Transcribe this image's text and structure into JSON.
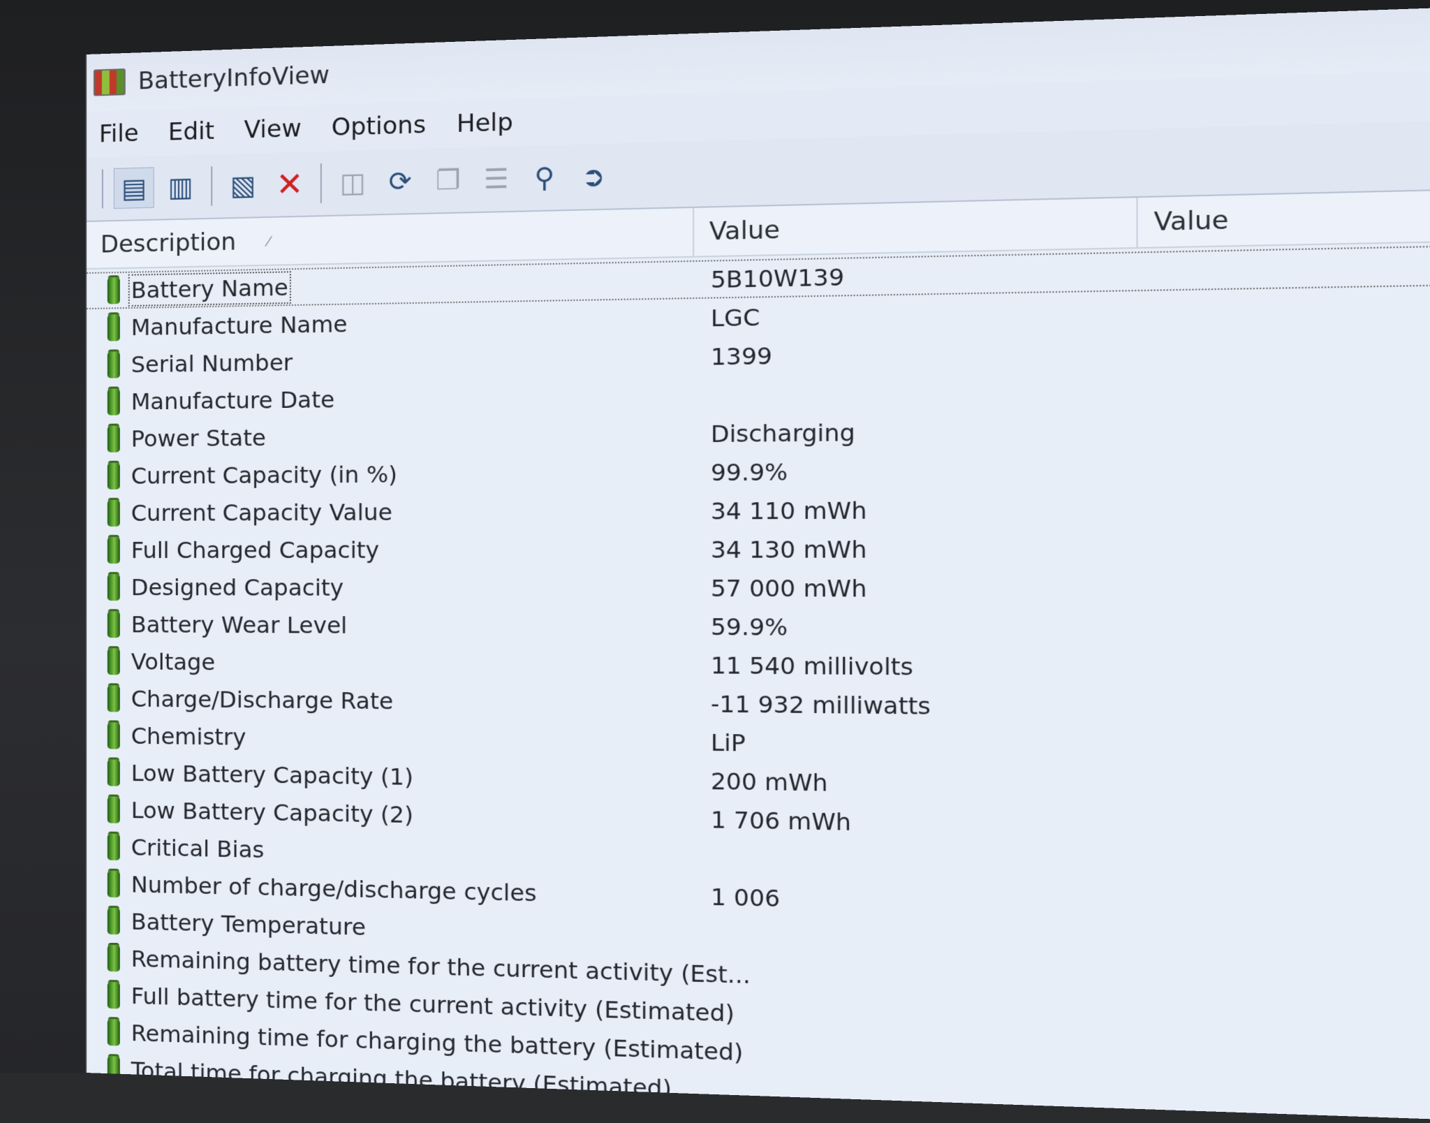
{
  "window": {
    "title": "BatteryInfoView"
  },
  "menu": [
    "File",
    "Edit",
    "View",
    "Options",
    "Help"
  ],
  "toolbar": {
    "icons": [
      "properties-icon",
      "clipboard-icon",
      "html-report-icon",
      "delete-icon",
      "save-icon",
      "refresh-icon",
      "copy-icon",
      "properties-disabled-icon",
      "find-icon",
      "exit-icon"
    ]
  },
  "columns": {
    "description": "Description",
    "value1": "Value",
    "value2": "Value"
  },
  "rows": [
    {
      "description": "Battery Name",
      "value": "5B10W139"
    },
    {
      "description": "Manufacture Name",
      "value": "LGC"
    },
    {
      "description": "Serial Number",
      "value": " 1399"
    },
    {
      "description": "Manufacture Date",
      "value": ""
    },
    {
      "description": "Power State",
      "value": "Discharging"
    },
    {
      "description": "Current Capacity (in %)",
      "value": "99.9%"
    },
    {
      "description": "Current Capacity Value",
      "value": "34 110 mWh"
    },
    {
      "description": "Full Charged Capacity",
      "value": "34 130 mWh"
    },
    {
      "description": "Designed Capacity",
      "value": "57 000 mWh"
    },
    {
      "description": "Battery Wear Level",
      "value": "59.9%"
    },
    {
      "description": "Voltage",
      "value": "11 540 millivolts"
    },
    {
      "description": "Charge/Discharge Rate",
      "value": "-11 932 milliwatts"
    },
    {
      "description": "Chemistry",
      "value": "LiP"
    },
    {
      "description": "Low Battery Capacity (1)",
      "value": "200 mWh"
    },
    {
      "description": "Low Battery Capacity (2)",
      "value": "1 706 mWh"
    },
    {
      "description": "Critical Bias",
      "value": ""
    },
    {
      "description": "Number of charge/discharge cycles",
      "value": "1 006"
    },
    {
      "description": "Battery Temperature",
      "value": ""
    },
    {
      "description": "Remaining battery time for the current activity (Est...",
      "value": ""
    },
    {
      "description": "Full battery time for the current activity (Estimated)",
      "value": ""
    },
    {
      "description": "Remaining time for charging the battery (Estimated)",
      "value": ""
    },
    {
      "description": "Total  time for charging the battery (Estimated)",
      "value": ""
    }
  ]
}
